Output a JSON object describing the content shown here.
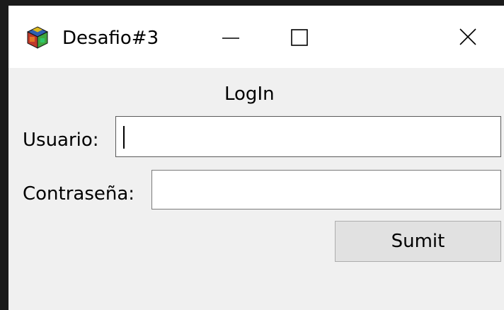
{
  "window": {
    "title": "Desafio#3",
    "controls": {
      "minimize": "minimize-icon",
      "maximize": "maximize-icon",
      "close": "close-icon"
    }
  },
  "form": {
    "heading": "LogIn",
    "user_label": "Usuario:",
    "user_value": "",
    "password_label": "Contraseña:",
    "password_value": "",
    "submit_label": "Sumit"
  },
  "colors": {
    "titlebar_bg": "#ffffff",
    "window_bg": "#f0f0f0",
    "button_bg": "#e1e1e1",
    "frame_bg": "#1b1b1b"
  }
}
